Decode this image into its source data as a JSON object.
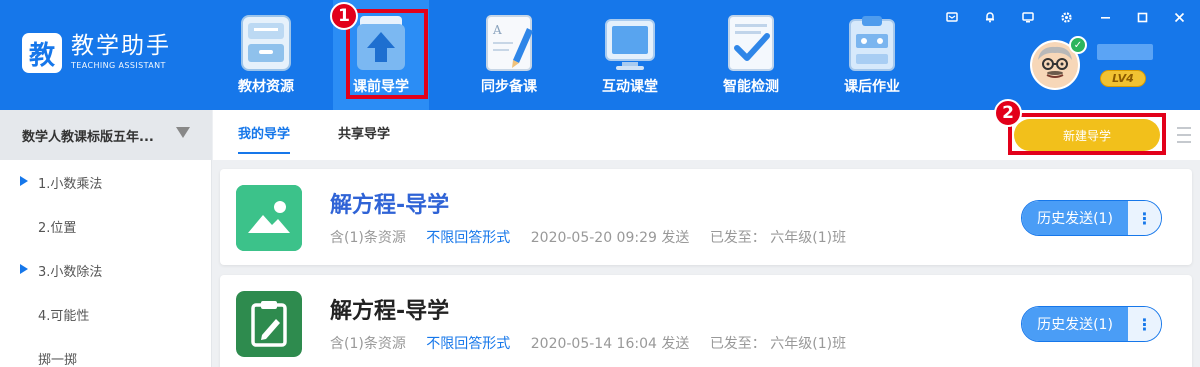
{
  "colors": {
    "brand": "#1677ea",
    "nav_active": "#2b8df5",
    "new_button": "#f2c01b",
    "callout": "#e2001a"
  },
  "logo": {
    "icon_char": "教",
    "title": "教学助手",
    "subtitle": "TEACHING ASSISTANT"
  },
  "nav": [
    {
      "label": "教材资源",
      "icon": "textbook-drawer-icon"
    },
    {
      "label": "课前导学",
      "icon": "upload-arrow-folder-icon",
      "active": true
    },
    {
      "label": "同步备课",
      "icon": "pencil-paper-icon"
    },
    {
      "label": "互动课堂",
      "icon": "monitor-icon"
    },
    {
      "label": "智能检测",
      "icon": "checklist-icon"
    },
    {
      "label": "课后作业",
      "icon": "clipboard-icon"
    }
  ],
  "window_controls": [
    "message-icon",
    "bell-icon",
    "screen-icon",
    "settings-icon",
    "minimize-icon",
    "maximize-icon",
    "close-icon"
  ],
  "user": {
    "level": "LV4"
  },
  "callouts": [
    "1",
    "2"
  ],
  "sidebar": {
    "book": "数学人教课标版五年...",
    "chapters": [
      {
        "label": "1.小数乘法",
        "expandable": true
      },
      {
        "label": "2.位置",
        "expandable": false
      },
      {
        "label": "3.小数除法",
        "expandable": true
      },
      {
        "label": "4.可能性",
        "expandable": false
      },
      {
        "label": "掷一掷",
        "expandable": false
      }
    ]
  },
  "tabs": [
    {
      "label": "我的导学",
      "active": true
    },
    {
      "label": "共享导学",
      "active": false
    }
  ],
  "actions": {
    "new_label": "新建导学"
  },
  "cards": [
    {
      "title": "解方程-导学",
      "title_color": "#2f63d6",
      "resources": "含(1)条资源",
      "answer_form": "不限回答形式",
      "sent_time": "2020-05-20 09:29 发送",
      "sent_to": "已发至： 六年级(1)班",
      "history_label": "历史发送(1)",
      "thumb_color": "#3cc28a",
      "thumb_icon": "image-icon"
    },
    {
      "title": "解方程-导学",
      "title_color": "#222222",
      "resources": "含(1)条资源",
      "answer_form": "不限回答形式",
      "sent_time": "2020-05-14 16:04 发送",
      "sent_to": "已发至： 六年级(1)班",
      "history_label": "历史发送(1)",
      "thumb_color": "#2e8b4e",
      "thumb_icon": "clipboard-edit-icon"
    }
  ]
}
